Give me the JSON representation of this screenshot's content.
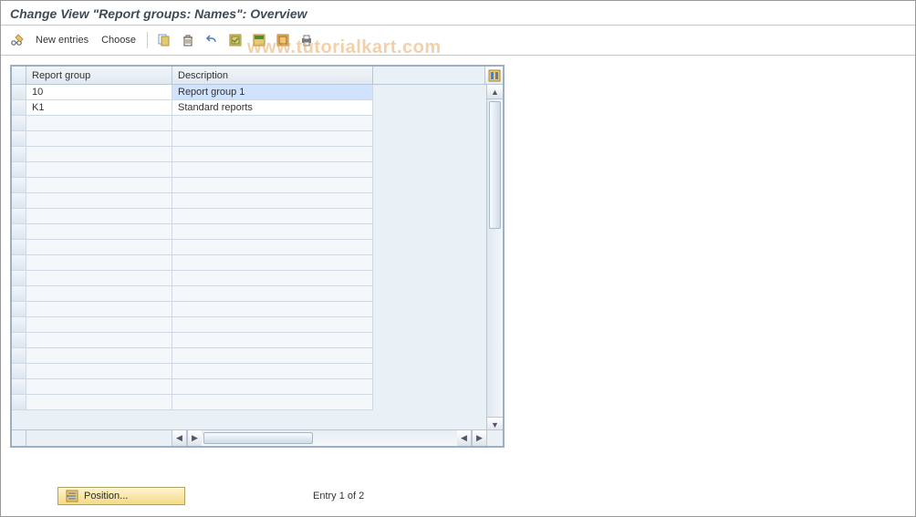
{
  "title": "Change View \"Report groups: Names\": Overview",
  "watermark": "www.tutorialkart.com",
  "toolbar": {
    "new_entries": "New entries",
    "choose": "Choose"
  },
  "table": {
    "columns": {
      "report_group": "Report group",
      "description": "Description"
    },
    "rows": [
      {
        "report_group": "10",
        "description": "Report group 1",
        "selected": true
      },
      {
        "report_group": "K1",
        "description": "Standard reports",
        "selected": false
      }
    ],
    "empty_rows": 19
  },
  "footer": {
    "position_btn": "Position...",
    "entry_text": "Entry 1 of 2"
  }
}
